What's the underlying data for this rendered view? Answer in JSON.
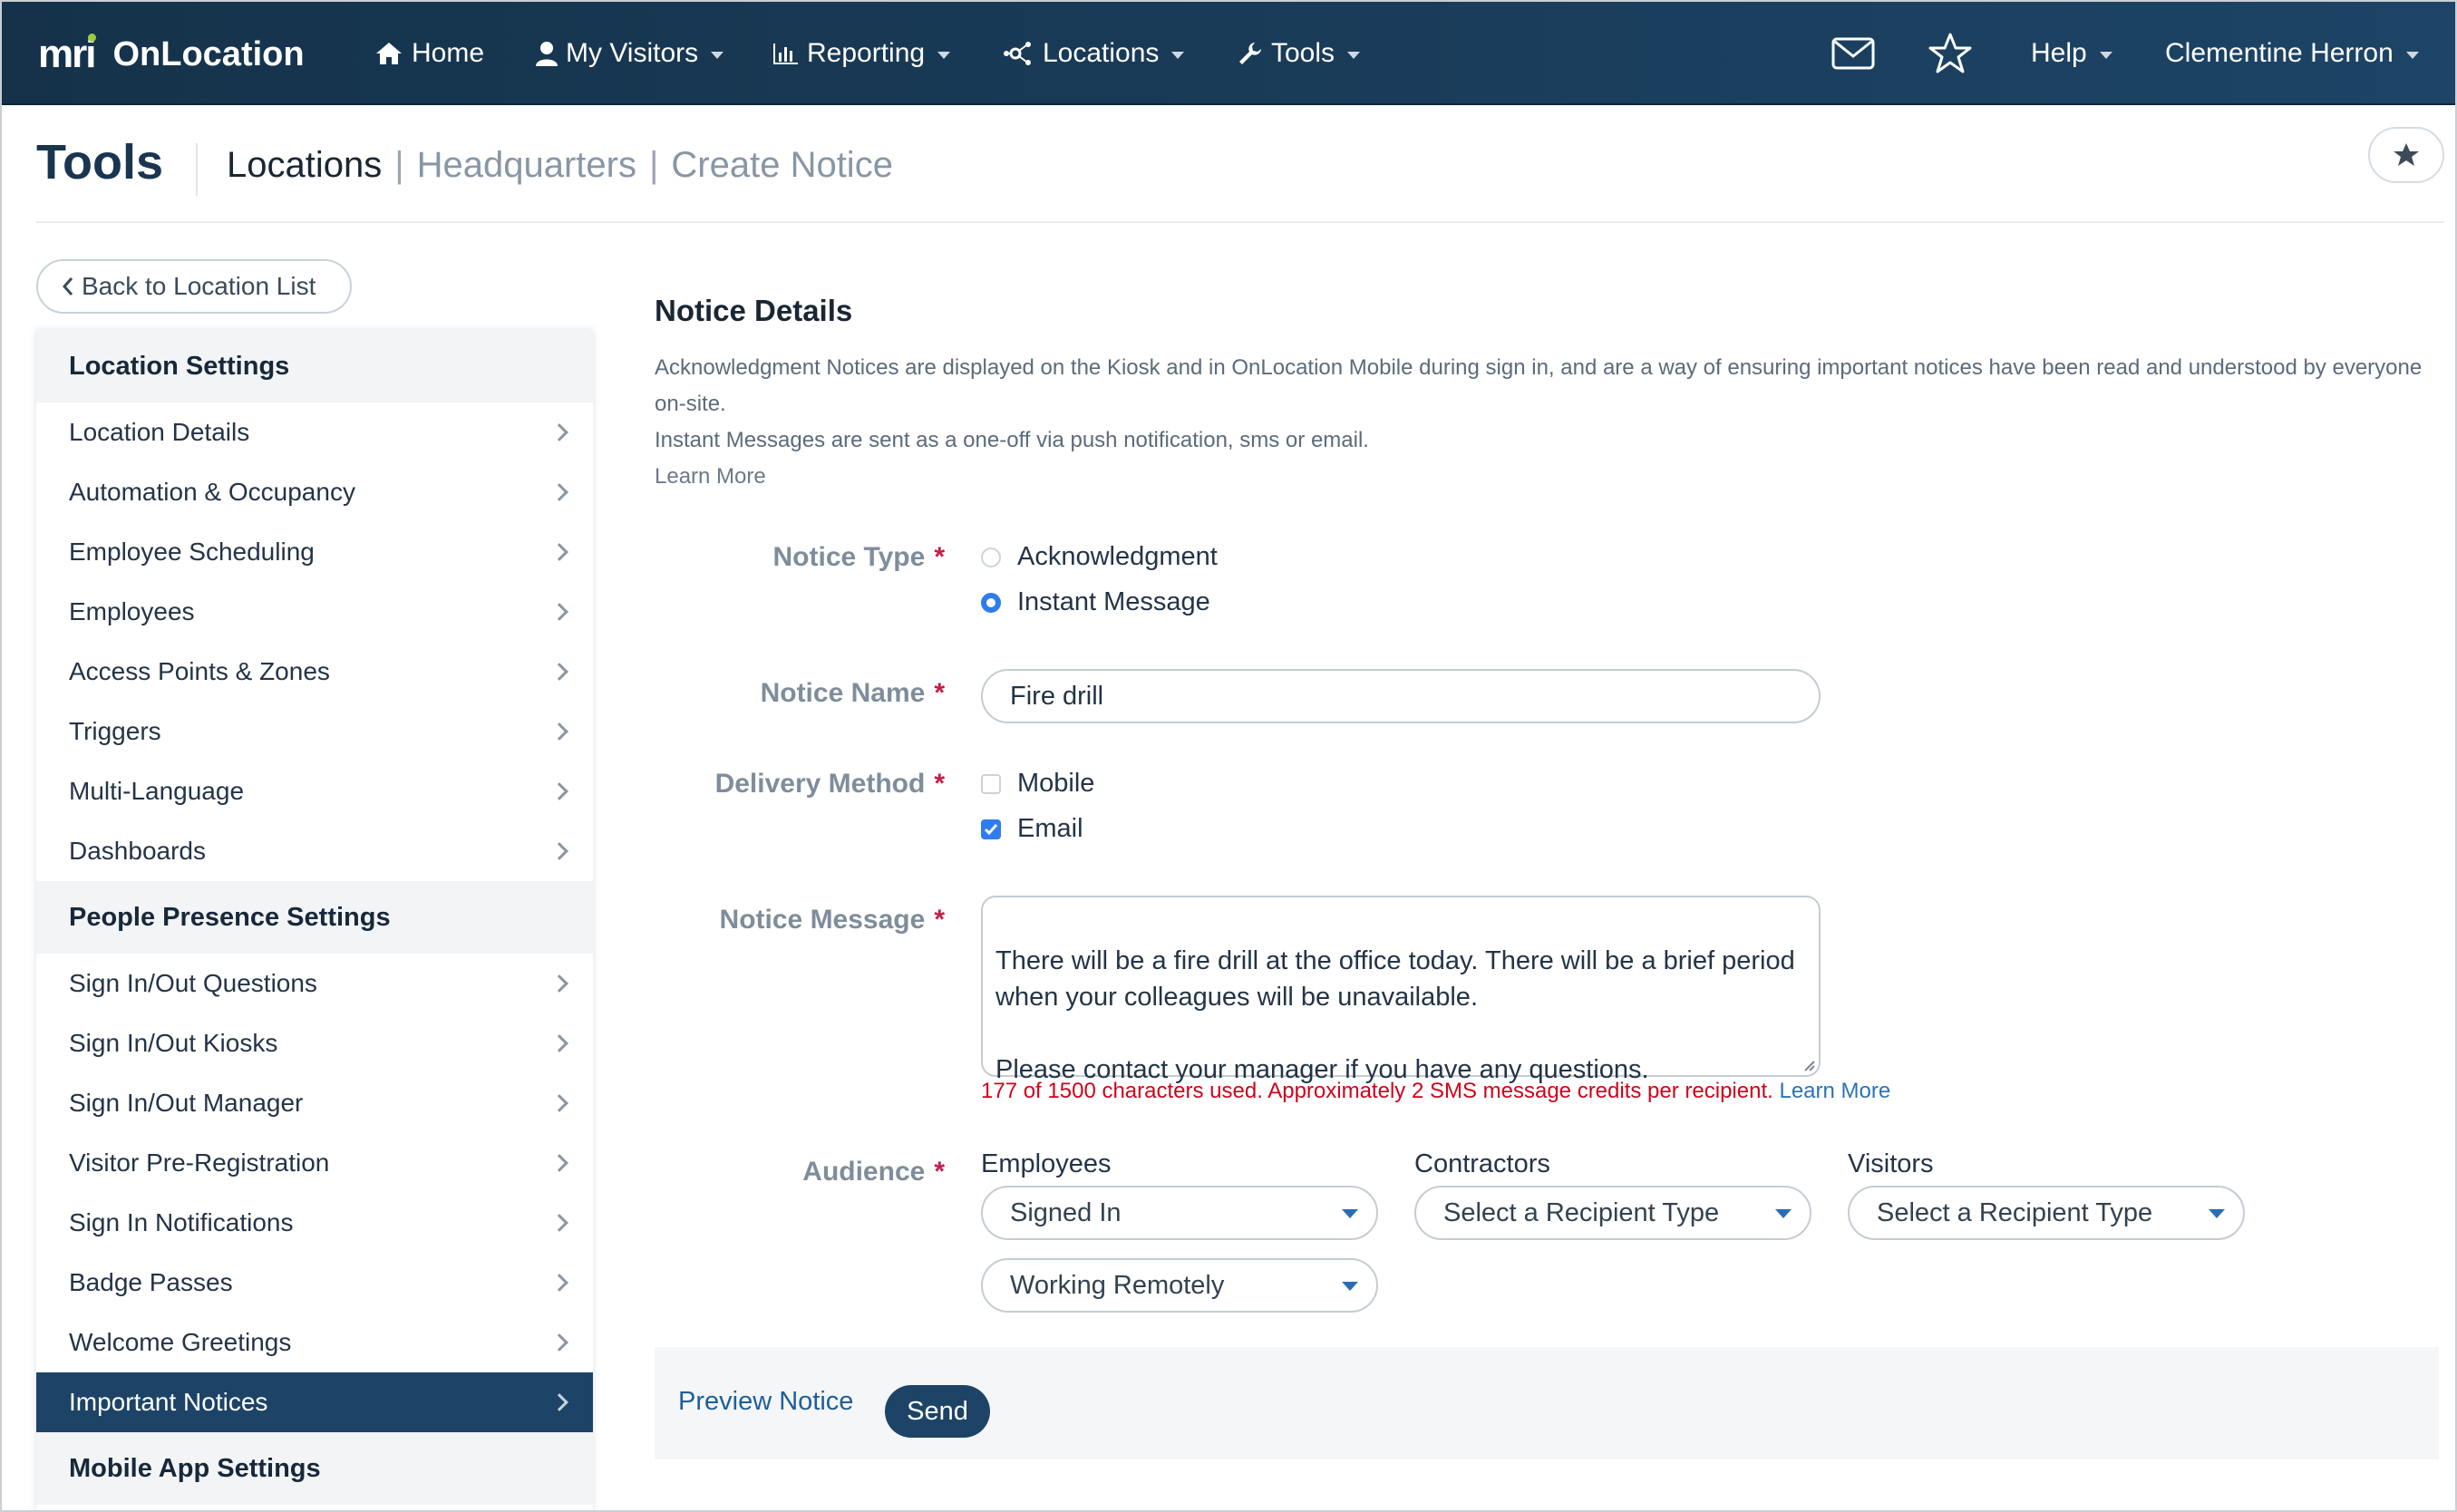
{
  "app": {
    "logo_mark": "mri",
    "name": "OnLocation"
  },
  "nav": {
    "home": "Home",
    "my_visitors": "My Visitors",
    "reporting": "Reporting",
    "locations": "Locations",
    "tools": "Tools",
    "help": "Help",
    "user": "Clementine Herron"
  },
  "header": {
    "title": "Tools",
    "crumbs": [
      "Locations",
      "Headquarters",
      "Create Notice"
    ],
    "separator": "|"
  },
  "sidebar": {
    "back": "Back to Location List",
    "sections": [
      {
        "title": "Location Settings",
        "items": [
          "Location Details",
          "Automation & Occupancy",
          "Employee Scheduling",
          "Employees",
          "Access Points & Zones",
          "Triggers",
          "Multi-Language",
          "Dashboards"
        ]
      },
      {
        "title": "People Presence Settings",
        "items": [
          "Sign In/Out Questions",
          "Sign In/Out Kiosks",
          "Sign In/Out Manager",
          "Visitor Pre-Registration",
          "Sign In Notifications",
          "Badge Passes",
          "Welcome Greetings",
          "Important Notices"
        ]
      },
      {
        "title": "Mobile App Settings",
        "items": []
      }
    ],
    "active_item": "Important Notices"
  },
  "form": {
    "section_title": "Notice Details",
    "desc_1": "Acknowledgment Notices are displayed on the Kiosk and in OnLocation Mobile during sign in, and are a way of ensuring important notices have been read and understood by everyone on-site.",
    "desc_2": "Instant Messages are sent as a one-off via push notification, sms or email.",
    "learn_more": "Learn More",
    "required_mark": "*",
    "notice_type": {
      "label": "Notice Type",
      "options": [
        "Acknowledgment",
        "Instant Message"
      ],
      "selected": "Instant Message"
    },
    "notice_name": {
      "label": "Notice Name",
      "value": "Fire drill"
    },
    "delivery": {
      "label": "Delivery Method",
      "options": [
        "Mobile",
        "Email"
      ],
      "checked": [
        "Email"
      ]
    },
    "message": {
      "label": "Notice Message",
      "value": "There will be a fire drill at the office today. There will be a brief period when your colleagues will be unavailable.\n\nPlease contact your manager if you have any questions.",
      "helper": "177 of 1500 characters used. Approximately 2 SMS message credits per recipient.",
      "helper_link": "Learn More"
    },
    "audience": {
      "label": "Audience",
      "employees": {
        "label": "Employees",
        "values": [
          "Signed In",
          "Working Remotely"
        ]
      },
      "contractors": {
        "label": "Contractors",
        "value": "Select a Recipient Type"
      },
      "visitors": {
        "label": "Visitors",
        "value": "Select a Recipient Type"
      }
    }
  },
  "actions": {
    "preview": "Preview Notice",
    "send": "Send"
  },
  "colors": {
    "nav_bg": "#1d4466",
    "accent_blue": "#2d7cf0",
    "required": "#c41d4b",
    "error_text": "#d0021b",
    "logo_dot": "#9ccc3c"
  },
  "icons": [
    "home-icon",
    "user-icon",
    "bar-chart-icon",
    "network-icon",
    "wrench-icon",
    "mail-icon",
    "star-icon",
    "chevron-left-icon",
    "chevron-right-icon"
  ]
}
